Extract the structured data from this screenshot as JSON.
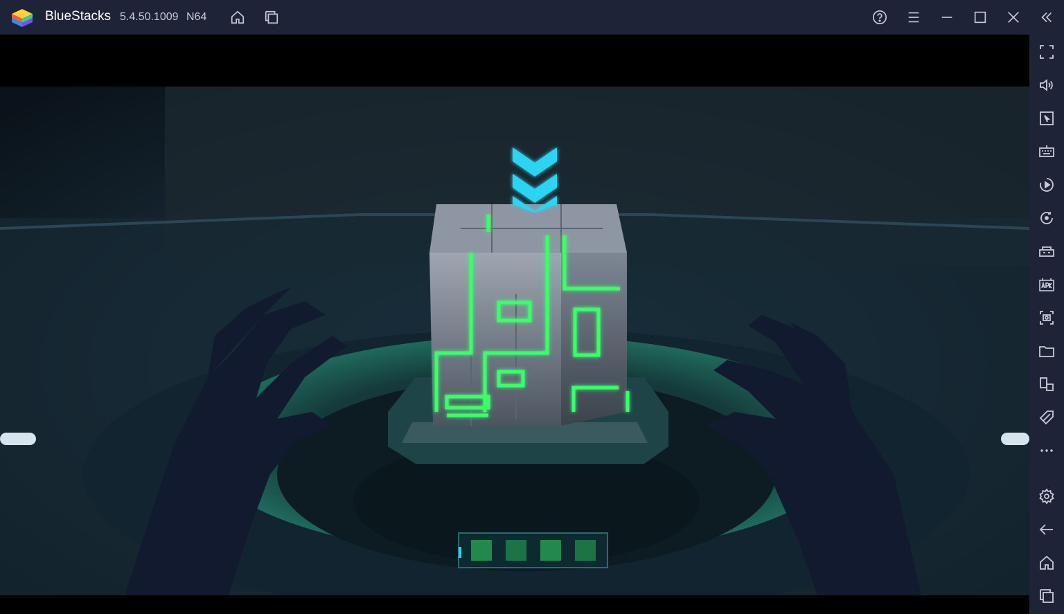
{
  "titlebar": {
    "app_name": "BlueStacks",
    "version": "5.4.50.1009",
    "arch": "N64",
    "icons": [
      "home-icon",
      "multi-instance-icon",
      "help-icon",
      "menu-icon",
      "minimize-icon",
      "maximize-icon",
      "close-icon",
      "collapse-sidebar-icon"
    ]
  },
  "sidebar": {
    "items": [
      {
        "icon": "fullscreen-icon"
      },
      {
        "icon": "volume-icon"
      },
      {
        "icon": "pointer-icon"
      },
      {
        "icon": "keyboard-icon"
      },
      {
        "icon": "macro-icon"
      },
      {
        "icon": "rotate-icon"
      },
      {
        "icon": "game-controls-icon"
      },
      {
        "icon": "install-apk-icon"
      },
      {
        "icon": "screenshot-icon"
      },
      {
        "icon": "folder-icon"
      },
      {
        "icon": "multi-instance-sync-icon"
      },
      {
        "icon": "eco-mode-icon"
      },
      {
        "icon": "more-icon"
      },
      {
        "icon": "settings-icon"
      },
      {
        "icon": "back-icon"
      },
      {
        "icon": "android-home-icon"
      },
      {
        "icon": "recent-apps-icon"
      }
    ]
  },
  "colors": {
    "chrome": "#1f2338",
    "icon": "#c9cbd8",
    "neon_green": "#39ff6a",
    "cyan": "#29d4f2"
  },
  "game": {
    "loading_progress": 0.05
  }
}
